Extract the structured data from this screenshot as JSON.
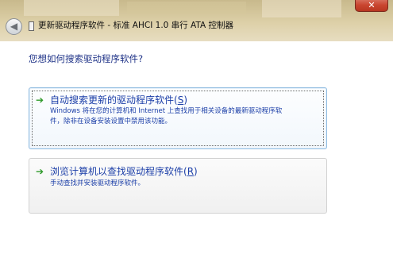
{
  "window": {
    "title": "更新驱动程序软件 - 标准 AHCI 1.0 串行 ATA 控制器",
    "close_glyph": "✕",
    "back_glyph": "◀"
  },
  "main": {
    "question": "您想如何搜索驱动程序软件?",
    "options": [
      {
        "title_prefix": "自动搜索更新的驱动程序软件(",
        "title_key": "S",
        "title_suffix": ")",
        "desc_line1": "Windows 将在您的计算机和 Internet 上查找用于相关设备的最新驱动程序软",
        "desc_line2": "件，除非在设备安装设置中禁用该功能。",
        "icon": "green-arrow-icon",
        "selected": true
      },
      {
        "title_prefix": "浏览计算机以查找驱动程序软件(",
        "title_key": "R",
        "title_suffix": ")",
        "desc_line1": "手动查找并安装驱动程序软件。",
        "icon": "green-arrow-icon",
        "selected": false
      }
    ]
  },
  "colors": {
    "link_blue": "#1c3fa8",
    "heading_blue": "#1e3287",
    "arrow_green": "#2f9a2a"
  }
}
